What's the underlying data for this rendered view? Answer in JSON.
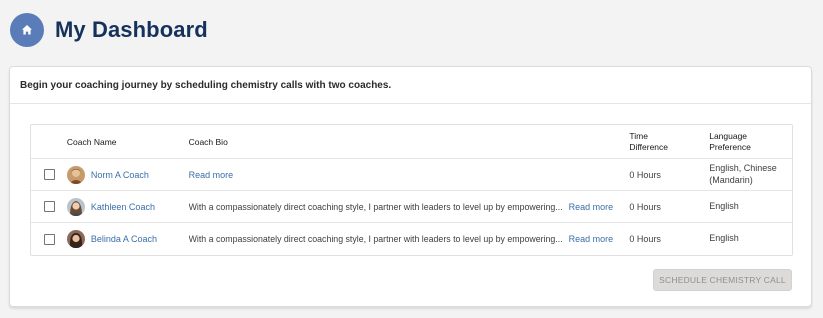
{
  "header": {
    "title": "My Dashboard",
    "icon": "home-icon",
    "icon_bg": "#5a7db9"
  },
  "card": {
    "intro": "Begin your coaching journey by scheduling chemistry calls with two coaches."
  },
  "table": {
    "columns": {
      "name": "Coach Name",
      "bio": "Coach Bio",
      "time_line1": "Time",
      "time_line2": "Difference",
      "lang_line1": "Language",
      "lang_line2": "Preference"
    },
    "rows": [
      {
        "name": "Norm A Coach",
        "bio": "",
        "read_more": "Read more",
        "time": "0 Hours",
        "language": "English, Chinese (Mandarin)"
      },
      {
        "name": "Kathleen Coach",
        "bio": "With a compassionately direct coaching style, I partner with leaders to level up by empowering...",
        "read_more": "Read more",
        "time": "0 Hours",
        "language": "English"
      },
      {
        "name": "Belinda A Coach",
        "bio": "With a compassionately direct coaching style, I partner with leaders to level up by empowering...",
        "read_more": "Read more",
        "time": "0 Hours",
        "language": "English"
      }
    ]
  },
  "actions": {
    "schedule_label": "SCHEDULE CHEMISTRY CALL"
  },
  "colors": {
    "title": "#16325c",
    "link": "#3b6ea8",
    "button_disabled_bg": "#dddbda"
  }
}
